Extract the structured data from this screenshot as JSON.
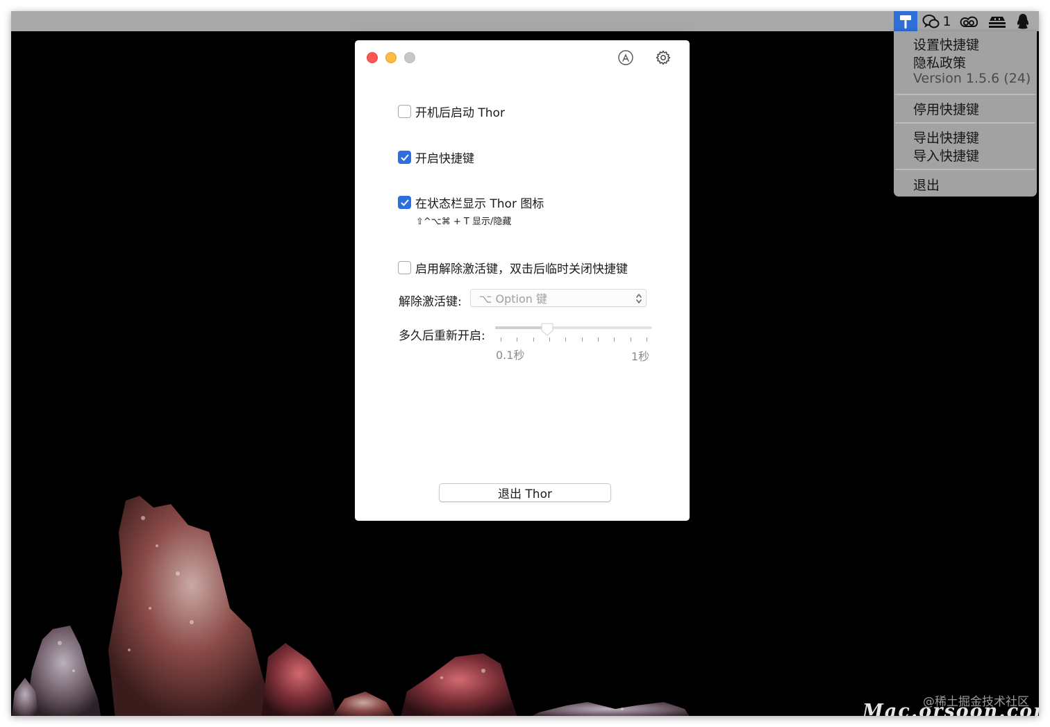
{
  "status_bar": {
    "wechat_badge_count": "1",
    "icons": [
      "thor-hammer-icon",
      "wechat-icon",
      "creative-cloud-icon",
      "stack-icon",
      "qq-penguin-icon"
    ]
  },
  "menu": {
    "items": [
      {
        "label": "设置快捷键",
        "enabled": true
      },
      {
        "label": "隐私政策",
        "enabled": true
      },
      {
        "label": "Version 1.5.6 (24)",
        "enabled": false
      },
      {
        "label": "停用快捷键",
        "enabled": true
      },
      {
        "label": "导出快捷键",
        "enabled": true
      },
      {
        "label": "导入快捷键",
        "enabled": true
      },
      {
        "label": "退出",
        "enabled": true
      }
    ]
  },
  "window": {
    "options": [
      {
        "label": "开机后启动 Thor",
        "checked": false
      },
      {
        "label": "开启快捷键",
        "checked": true
      },
      {
        "label": "在状态栏显示 Thor 图标",
        "checked": true
      },
      {
        "label": "启用解除激活键，双击后临时关闭快捷键",
        "checked": false
      }
    ],
    "status_bar_hint": "⇧^⌥⌘ + T 显示/隐藏",
    "deactivate_key_label": "解除激活键:",
    "deactivate_key_value": "⌥ Option 键",
    "reenable_label": "多久后重新开启:",
    "slider": {
      "min_label": "0.1秒",
      "max_label": "1秒",
      "min": 0.1,
      "max": 1.0,
      "value": 0.4,
      "ticks": 10
    },
    "quit_button": "退出 Thor"
  },
  "watermark": {
    "community": "@稀土掘金技术社区",
    "site": "Mac.orsoon.com"
  },
  "colors": {
    "accent": "#2d6ee0",
    "menubar": "#a9a9a9",
    "menu_bg": "#a2a2a2",
    "close": "#fc5753",
    "minimize": "#fdbc40",
    "zoom": "#c8c8c8"
  }
}
